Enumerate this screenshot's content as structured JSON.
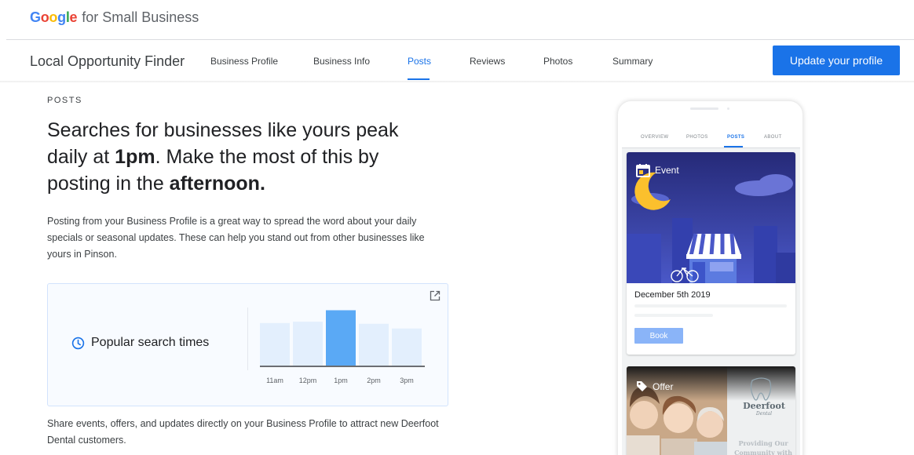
{
  "brand": {
    "google": "Google",
    "suffix": "for Small Business"
  },
  "nav": {
    "title": "Local Opportunity Finder",
    "items": [
      {
        "label": "Business Profile"
      },
      {
        "label": "Business Info"
      },
      {
        "label": "Posts",
        "active": true
      },
      {
        "label": "Reviews"
      },
      {
        "label": "Photos"
      },
      {
        "label": "Summary"
      }
    ],
    "cta": "Update your profile"
  },
  "main": {
    "eyebrow": "POSTS",
    "headline": {
      "p1": "Searches for businesses like yours peak daily at ",
      "b1": "1pm",
      "p2": ". Make the most of this by posting in the ",
      "b2": "afternoon."
    },
    "paragraph1": "Posting from your Business Profile is a great way to spread the word about your daily specials or seasonal updates. These can help you stand out from other businesses like yours in Pinson.",
    "card": {
      "label": "Popular search times"
    },
    "paragraph2": "Share events, offers, and updates directly on your Business Profile to attract new Deerfoot Dental customers."
  },
  "chart_data": {
    "type": "bar",
    "categories": [
      "11am",
      "12pm",
      "1pm",
      "2pm",
      "3pm"
    ],
    "values": [
      63,
      65,
      82,
      62,
      55
    ],
    "highlight_index": 2,
    "title": "",
    "xlabel": "",
    "ylabel": "",
    "ylim": [
      0,
      100
    ],
    "grid": false,
    "colors": {
      "bar": "#e3effd",
      "highlight": "#5aa9f5",
      "baseline": "#3c4043"
    }
  },
  "phone": {
    "tabs": [
      {
        "label": "OVERVIEW"
      },
      {
        "label": "PHOTOS"
      },
      {
        "label": "POSTS",
        "active": true
      },
      {
        "label": "ABOUT"
      }
    ],
    "event": {
      "tag": "Event",
      "date": "December 5th 2019",
      "button": "Book"
    },
    "offer": {
      "tag": "Offer",
      "logo_name": "Deerfoot",
      "logo_sub": "Dental",
      "tagline": "Providing Our Community with"
    }
  },
  "colors": {
    "accent": "#1a73e8",
    "chart_highlight": "#5aa9f5",
    "chart_bar": "#e3effd"
  },
  "icons": [
    "open-in-new-icon",
    "clock-icon",
    "calendar-icon",
    "tag-icon",
    "tooth-icon"
  ]
}
